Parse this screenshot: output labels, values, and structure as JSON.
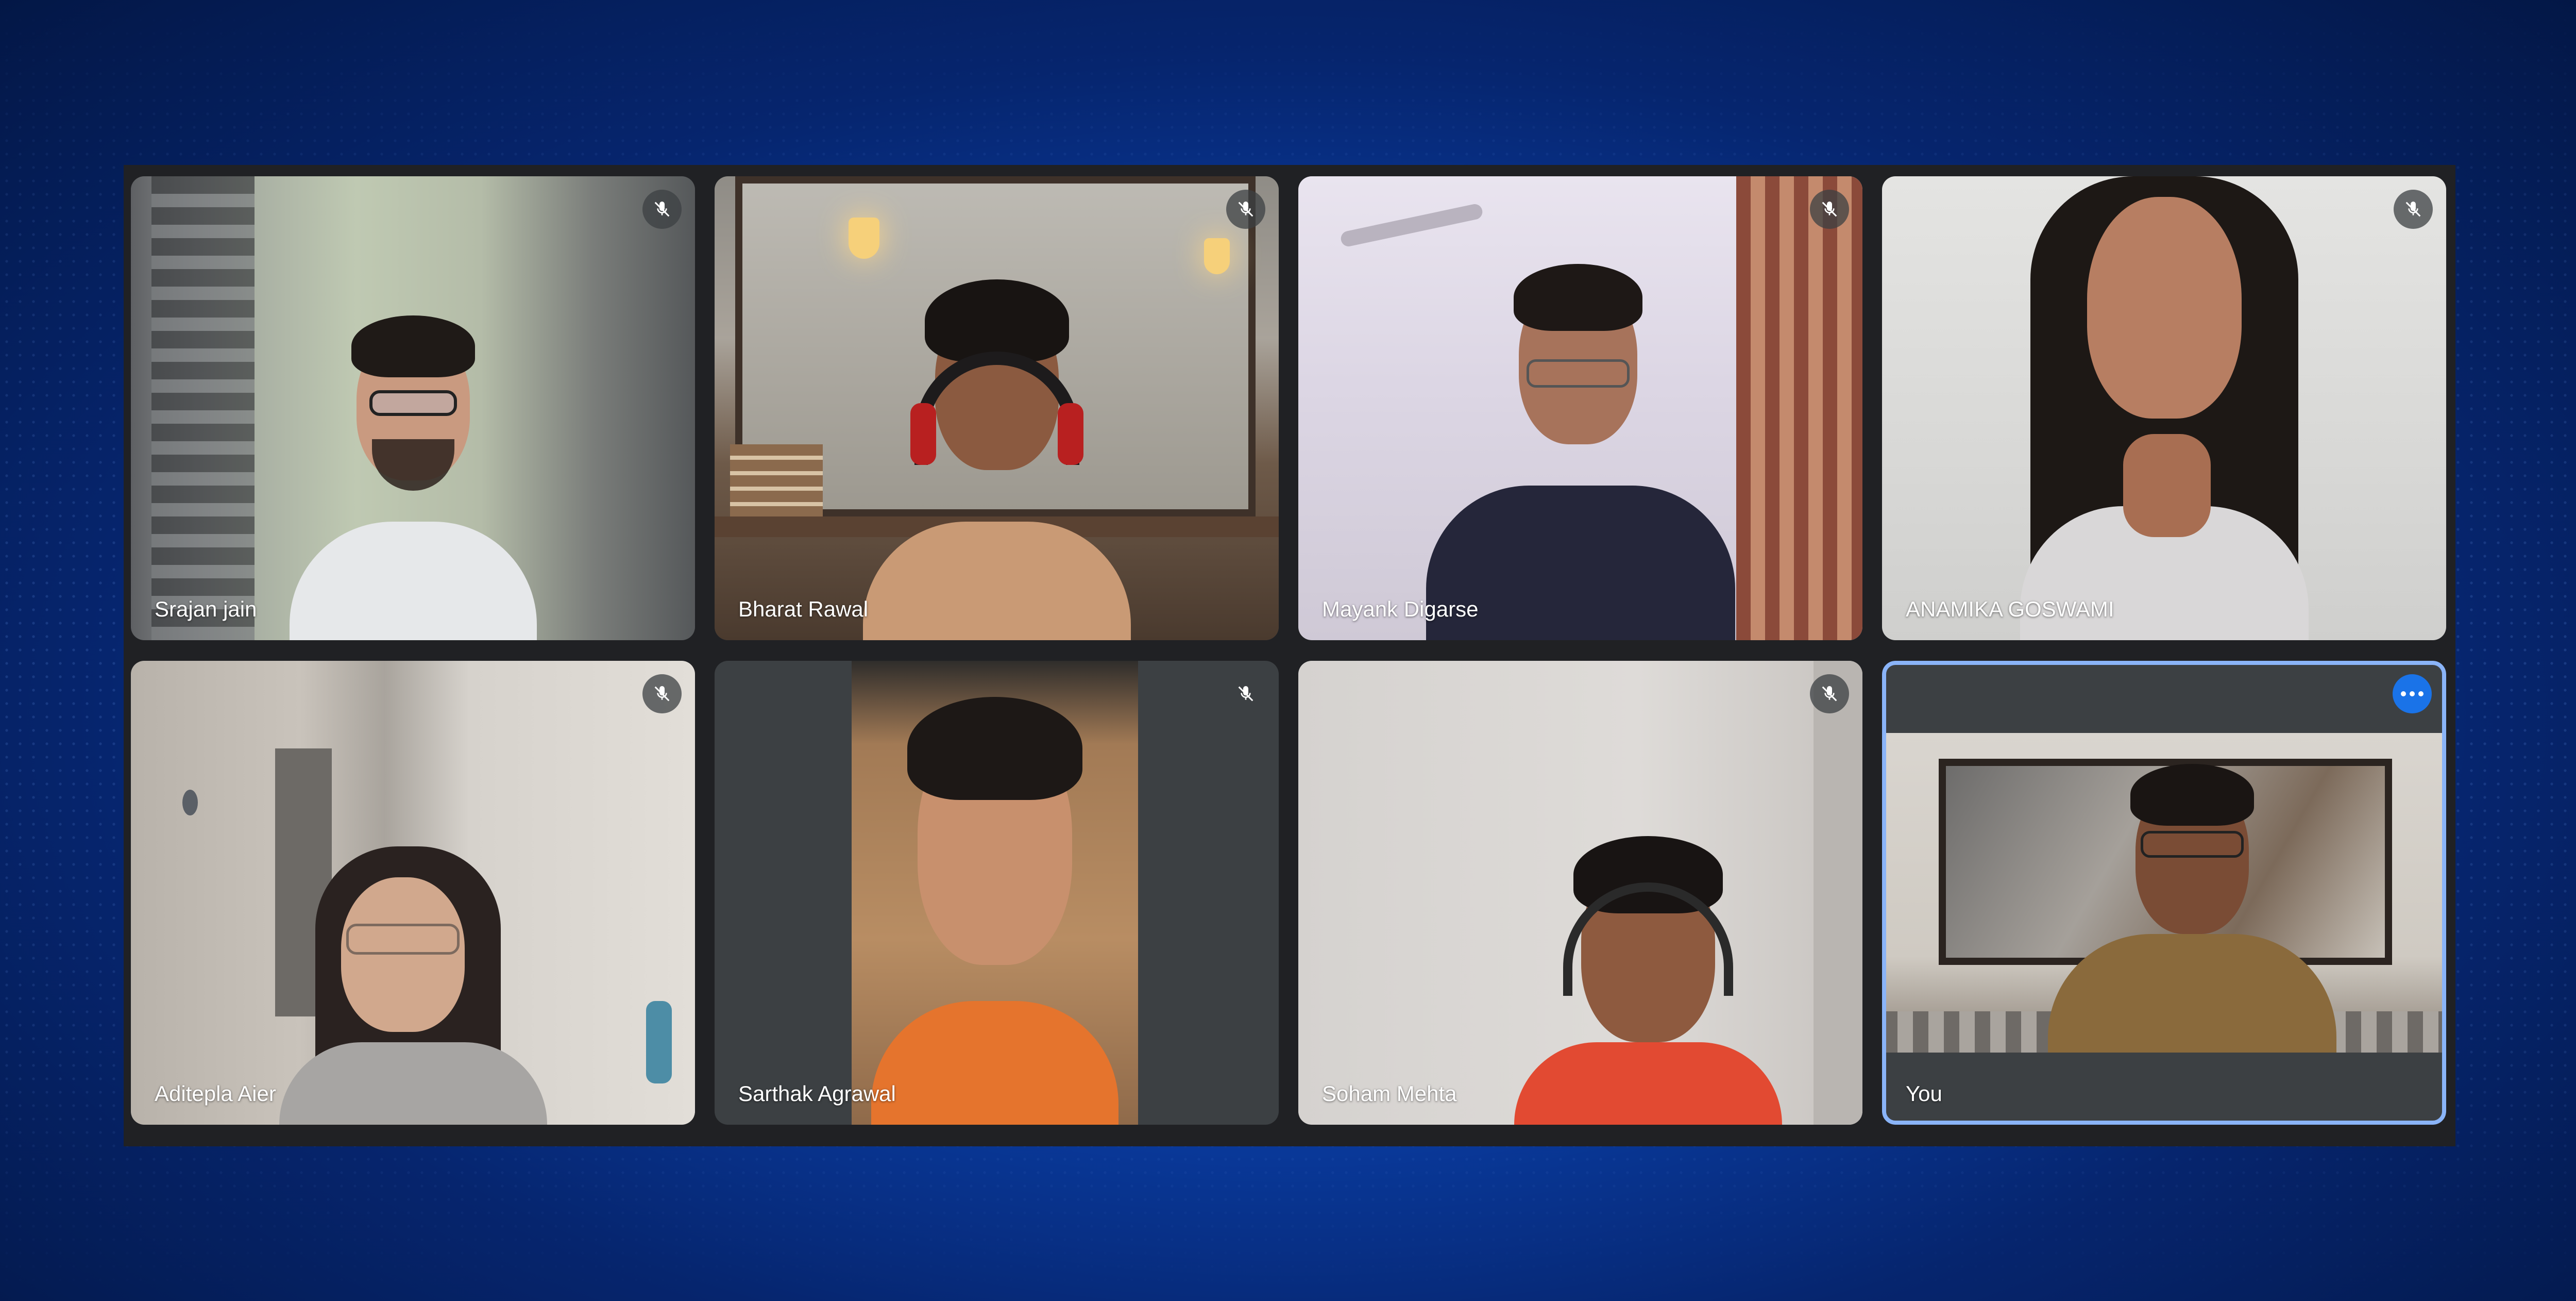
{
  "participants": [
    {
      "name": "Srajan jain",
      "muted": true
    },
    {
      "name": "Bharat Rawal",
      "muted": true
    },
    {
      "name": "Mayank Digarse",
      "muted": true
    },
    {
      "name": "ANAMIKA GOSWAMI",
      "muted": true
    },
    {
      "name": "Aditepla Aier",
      "muted": true
    },
    {
      "name": "Sarthak Agrawal",
      "muted": true
    },
    {
      "name": "Soham Mehta",
      "muted": true
    },
    {
      "name": "You",
      "muted": false,
      "is_self": true
    }
  ],
  "icons": {
    "muted": "mic-off-icon",
    "more": "more-options-icon"
  },
  "colors": {
    "window_bg": "#202124",
    "self_highlight": "#8ab4f8",
    "more_button": "#1a73e8"
  }
}
